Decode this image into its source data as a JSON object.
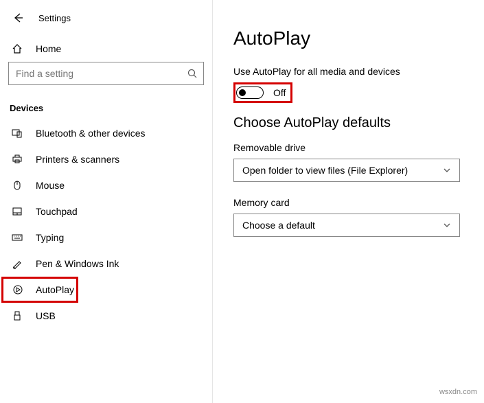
{
  "header": {
    "app_title": "Settings"
  },
  "sidebar": {
    "home_label": "Home",
    "search_placeholder": "Find a setting",
    "category_label": "Devices",
    "items": [
      {
        "label": "Bluetooth & other devices"
      },
      {
        "label": "Printers & scanners"
      },
      {
        "label": "Mouse"
      },
      {
        "label": "Touchpad"
      },
      {
        "label": "Typing"
      },
      {
        "label": "Pen & Windows Ink"
      },
      {
        "label": "AutoPlay"
      },
      {
        "label": "USB"
      }
    ]
  },
  "main": {
    "title": "AutoPlay",
    "toggle_label": "Use AutoPlay for all media and devices",
    "toggle_state": "Off",
    "defaults_heading": "Choose AutoPlay defaults",
    "removable_label": "Removable drive",
    "removable_value": "Open folder to view files (File Explorer)",
    "memory_label": "Memory card",
    "memory_value": "Choose a default"
  },
  "watermark": "wsxdn.com"
}
